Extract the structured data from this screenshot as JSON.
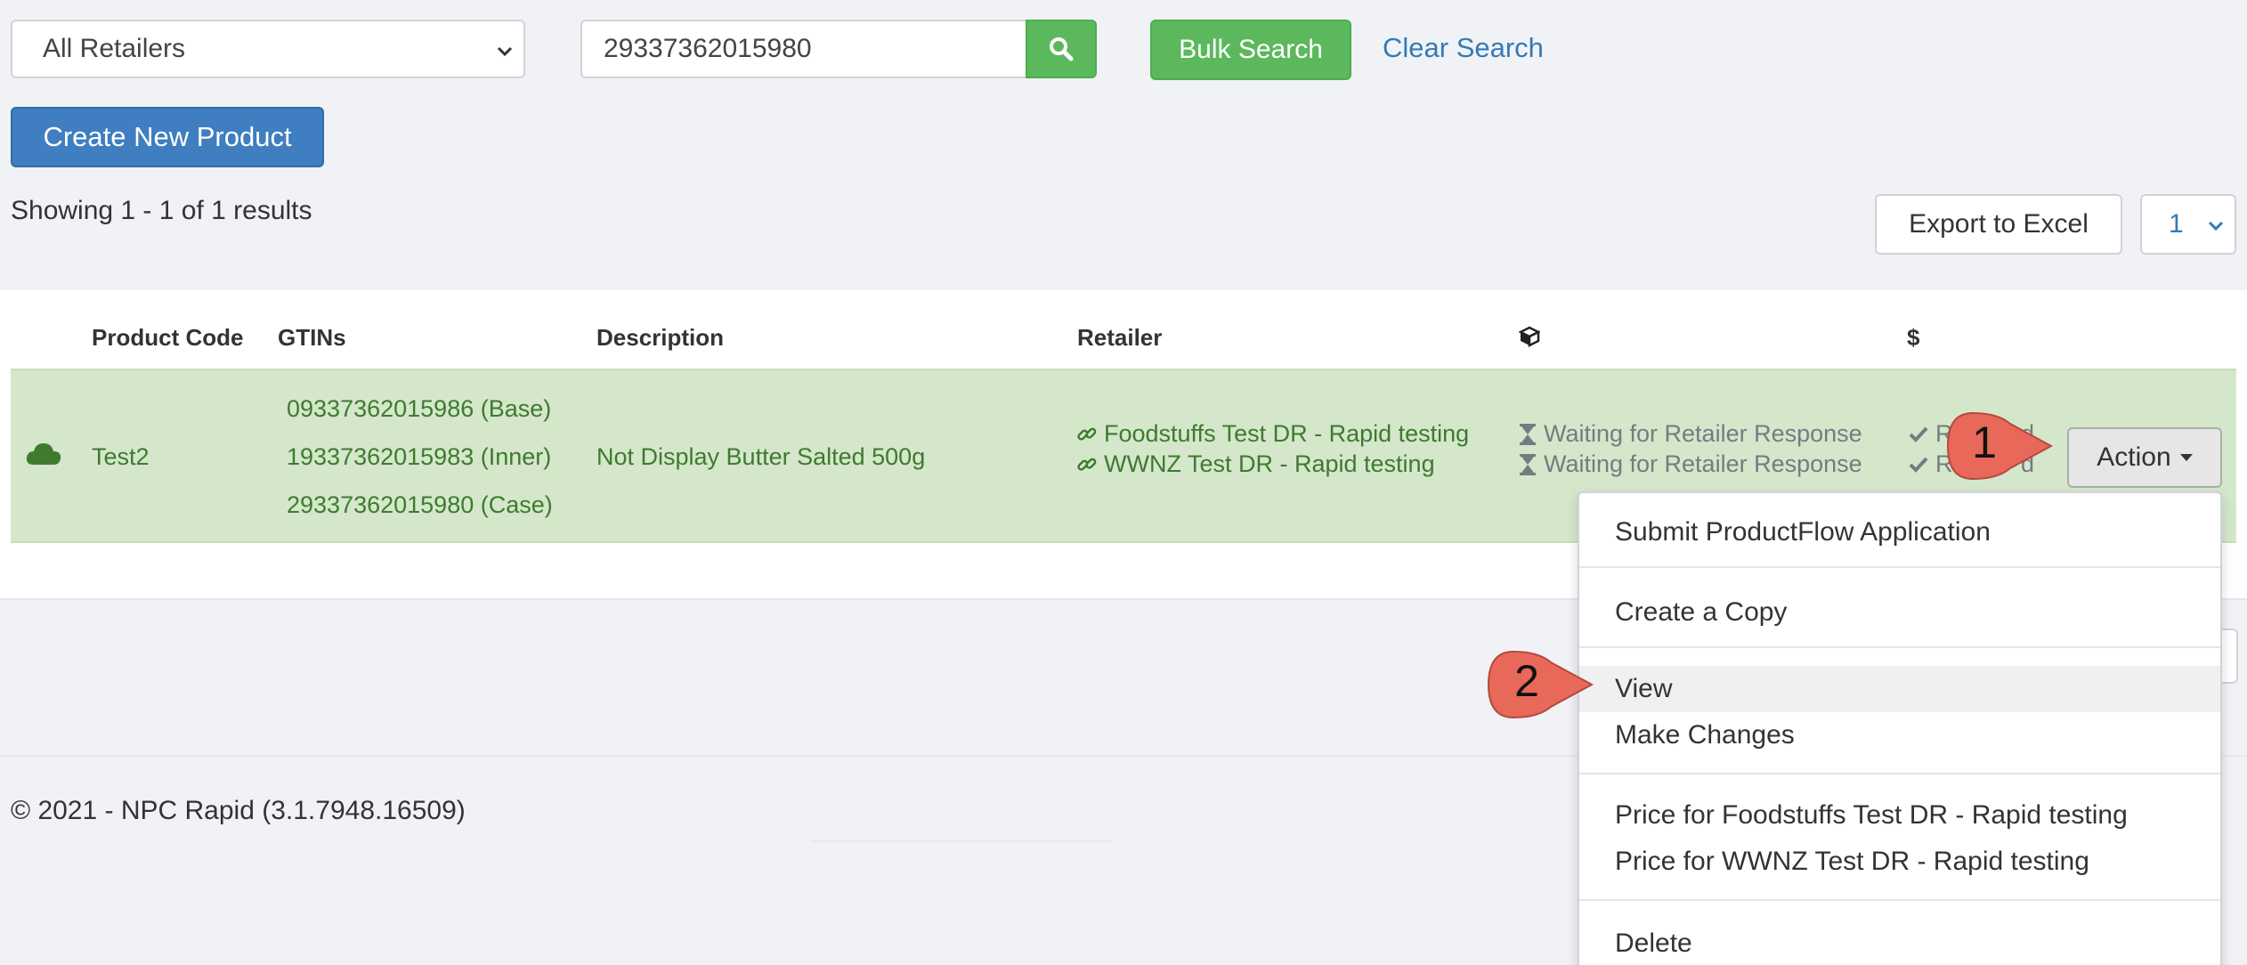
{
  "toolbar": {
    "retailer_select_value": "All Retailers",
    "search_value": "29337362015980",
    "bulk_search_label": "Bulk Search",
    "clear_search_label": "Clear Search",
    "create_label": "Create New Product"
  },
  "results": {
    "summary": "Showing 1 - 1 of 1 results",
    "export_label": "Export to Excel",
    "page_value": "1"
  },
  "table": {
    "headers": {
      "product_code": "Product Code",
      "gtins": "GTINs",
      "description": "Description",
      "retailer": "Retailer",
      "package_icon": "package-icon",
      "price": "$"
    },
    "row": {
      "status_icon": "cloud-icon",
      "product_code": "Test2",
      "gtins": [
        "09337362015986 (Base)",
        "19337362015983 (Inner)",
        "29337362015980 (Case)"
      ],
      "description": "Not Display Butter Salted 500g",
      "retailers": [
        "Foodstuffs Test DR - Rapid testing",
        "WWNZ Test DR - Rapid testing"
      ],
      "statuses": [
        "Waiting for Retailer Response",
        "Waiting for Retailer Response"
      ],
      "price_status_fragments": [
        "R",
        "d",
        "R",
        "d"
      ],
      "action_label": "Action"
    }
  },
  "dropdown": {
    "submit": "Submit ProductFlow Application",
    "copy": "Create a Copy",
    "view": "View",
    "make_changes": "Make Changes",
    "price_foodstuffs": "Price for Foodstuffs Test DR - Rapid testing",
    "price_wwnz": "Price for WWNZ Test DR - Rapid testing",
    "delete": "Delete"
  },
  "footer": {
    "copyright": "© 2021 - NPC Rapid (3.1.7948.16509)"
  },
  "callouts": {
    "first": "1",
    "second": "2",
    "color": "#e8685a"
  },
  "colors": {
    "green_button": "#5cb85c",
    "blue_button": "#3f7ec0",
    "row_highlight": "#d4e7cb",
    "link": "#337ab7"
  }
}
